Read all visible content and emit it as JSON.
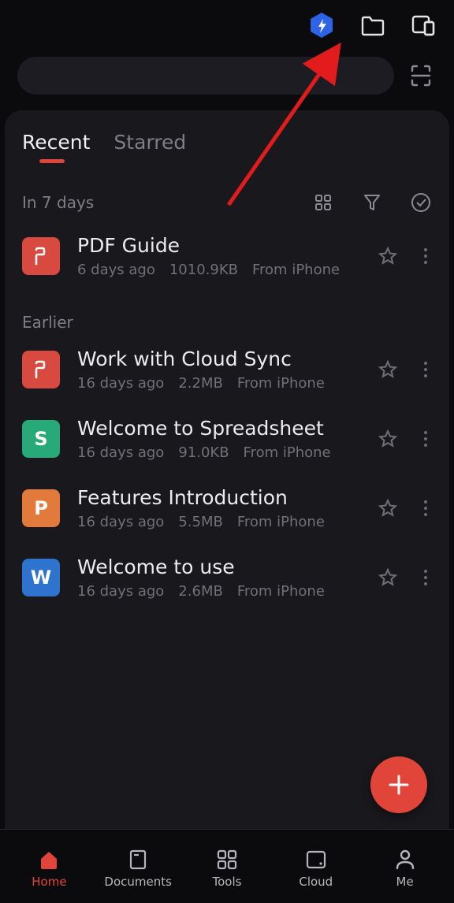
{
  "tabs": {
    "recent": "Recent",
    "starred": "Starred"
  },
  "sections": {
    "in7days": "In 7 days",
    "earlier": "Earlier"
  },
  "files": {
    "recent": [
      {
        "name": "PDF Guide",
        "age": "6 days ago",
        "size": "1010.9KB",
        "source": "From iPhone",
        "type": "pdf",
        "letter": "P"
      }
    ],
    "earlier": [
      {
        "name": "Work with Cloud Sync",
        "age": "16 days ago",
        "size": "2.2MB",
        "source": "From iPhone",
        "type": "pdf",
        "letter": "P"
      },
      {
        "name": "Welcome to Spreadsheet",
        "age": "16 days ago",
        "size": "91.0KB",
        "source": "From iPhone",
        "type": "sheet",
        "letter": "S"
      },
      {
        "name": "Features Introduction",
        "age": "16 days ago",
        "size": "5.5MB",
        "source": "From iPhone",
        "type": "ppt",
        "letter": "P"
      },
      {
        "name": "Welcome to use",
        "age": "16 days ago",
        "size": "2.6MB",
        "source": "From iPhone",
        "type": "doc",
        "letter": "W"
      }
    ]
  },
  "nav": {
    "home": "Home",
    "documents": "Documents",
    "tools": "Tools",
    "cloud": "Cloud",
    "me": "Me"
  },
  "colors": {
    "accent": "#e1453a"
  }
}
